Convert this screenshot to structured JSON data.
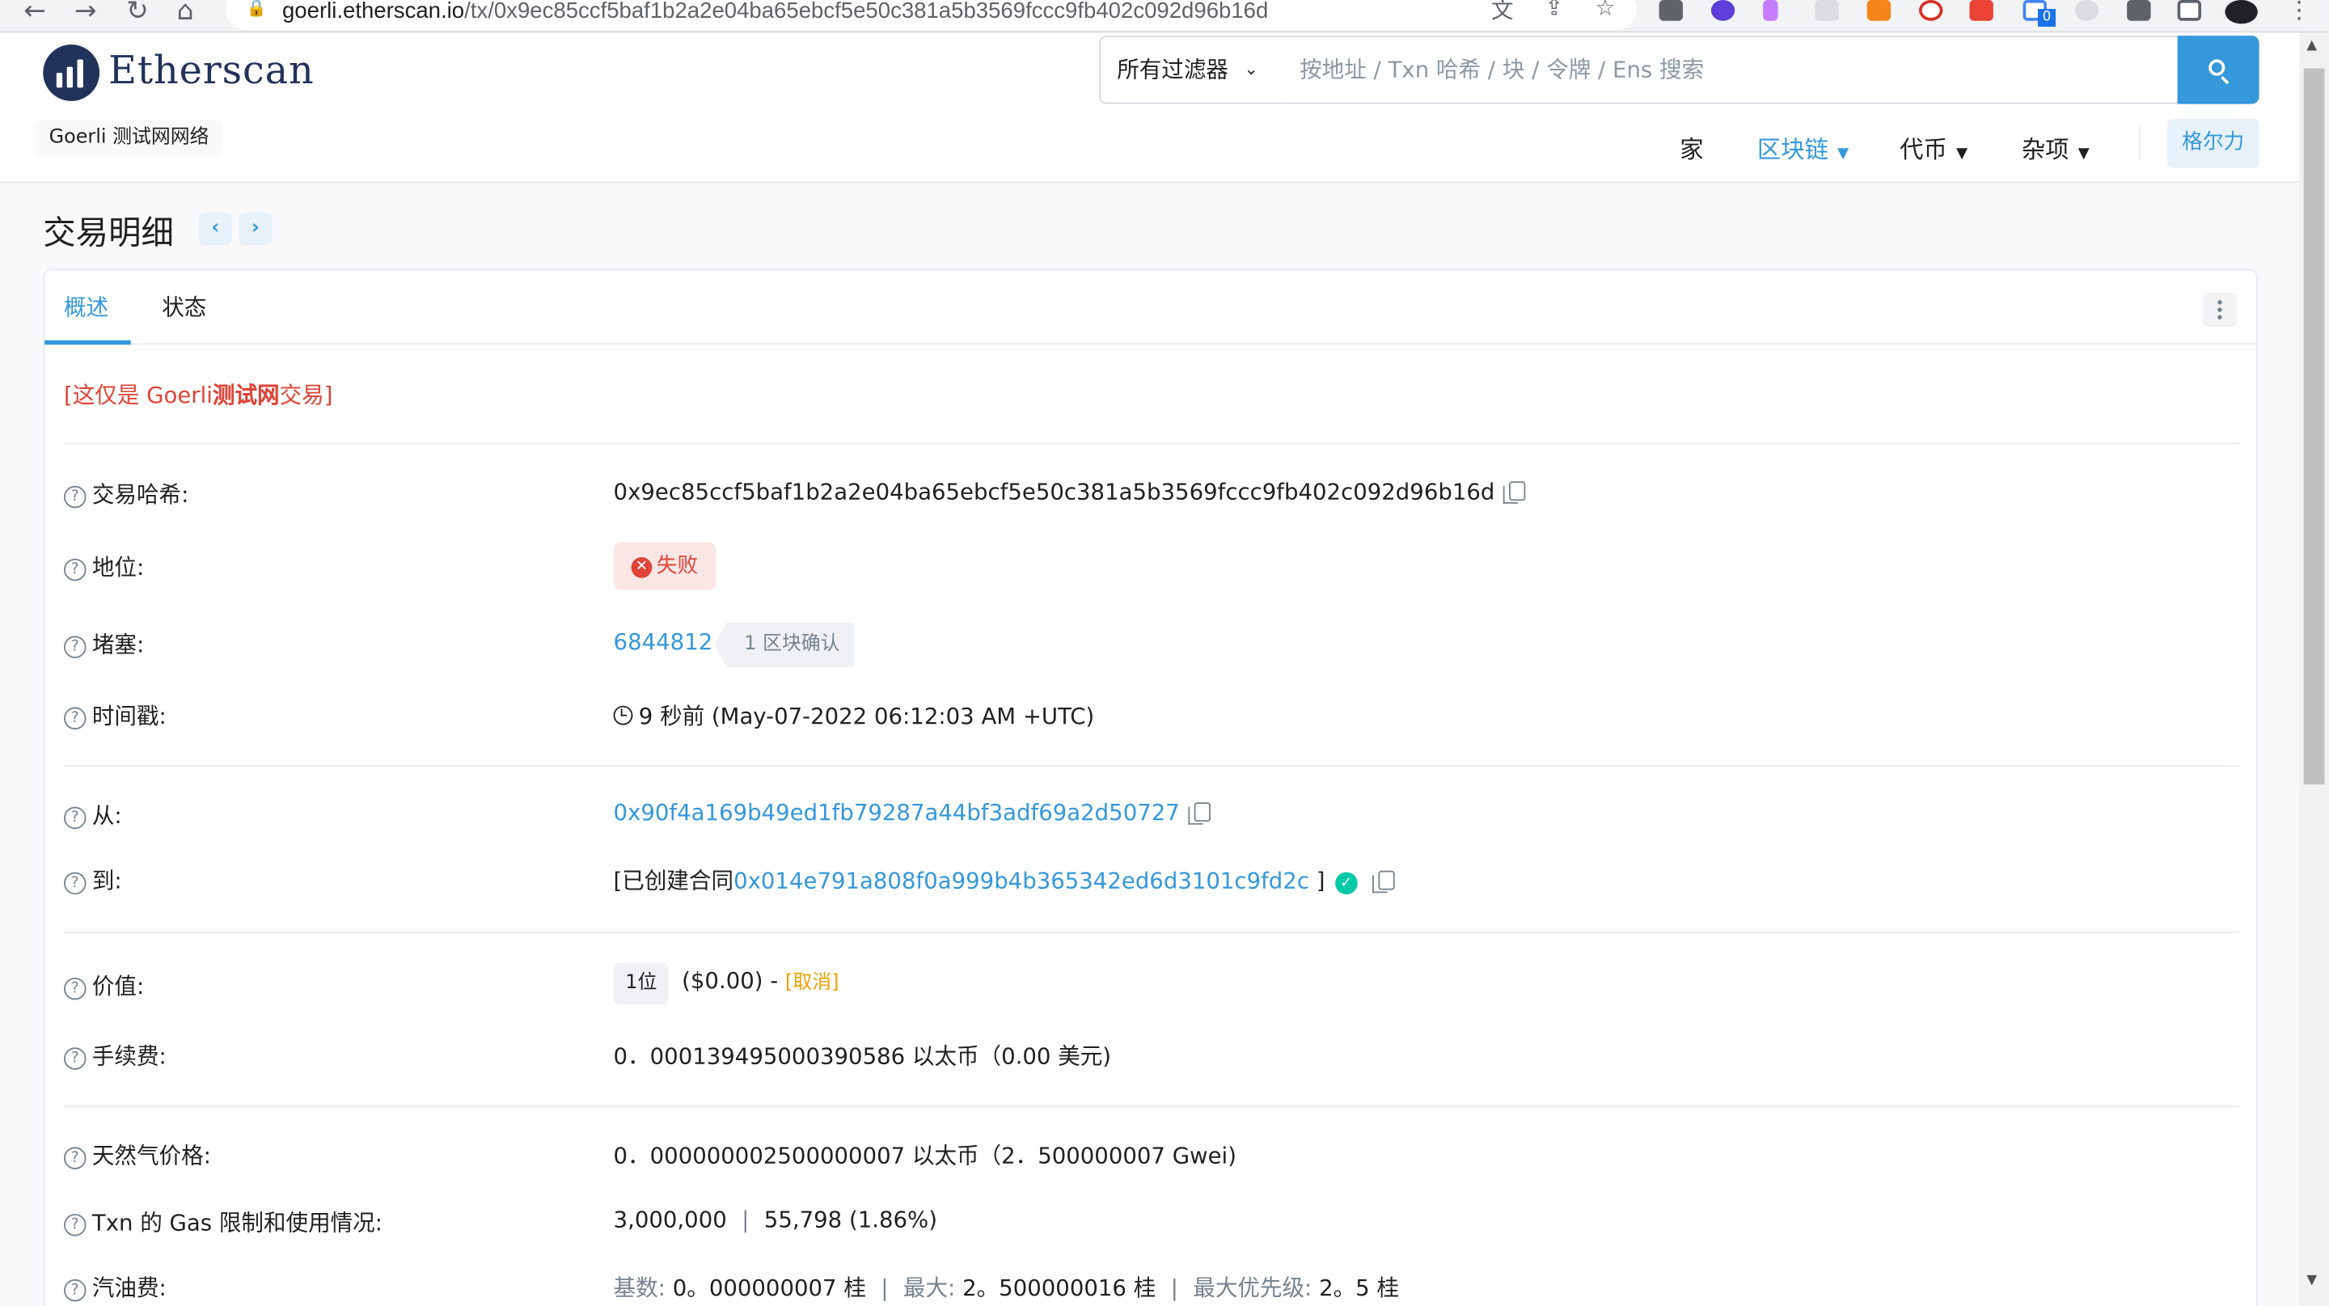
{
  "browser": {
    "url_host": "goerli.etherscan.io",
    "url_path": "/tx/0x9ec85ccf5baf1b2a2e04ba65ebcf5e50c381a5b3569fccc9fb402c092d96b16d",
    "ext_badge": "0"
  },
  "header": {
    "logo_text": "Etherscan",
    "network_badge": "Goerli 测试网网络",
    "filter_label": "所有过滤器",
    "search_placeholder": "按地址 / Txn 哈希 / 块 / 令牌 / Ens 搜索",
    "nav": {
      "home": "家",
      "blockchain": "区块链",
      "tokens": "代币",
      "misc": "杂项",
      "network": "格尔力"
    }
  },
  "page": {
    "title": "交易明细",
    "tabs": [
      "概述",
      "状态"
    ]
  },
  "overview": {
    "notice_prefix": "[这仅是 Goerli",
    "notice_bold": "测试网",
    "notice_suffix": "交易]",
    "tx_hash_label": "交易哈希:",
    "tx_hash": "0x9ec85ccf5baf1b2a2e04ba65ebcf5e50c381a5b3569fccc9fb402c092d96b16d",
    "status_label": "地位:",
    "status": "失败",
    "block_label": "堵塞:",
    "block": "6844812",
    "confirmations": "1 区块确认",
    "timestamp_label": "时间戳:",
    "timestamp": "9 秒前 (May-07-2022 06:12:03 AM +UTC)",
    "from_label": "从:",
    "from": "0x90f4a169b49ed1fb79287a44bf3adf69a2d50727",
    "to_label": "到:",
    "to_prefix": "[已创建合同",
    "to_contract": "0x014e791a808f0a999b4b365342ed6d3101c9fd2c",
    "to_suffix": "]",
    "value_label": "价值:",
    "value_badge": "1位",
    "value_usd": "($0.00) -",
    "value_cancel": "[取消]",
    "fee_label": "手续费:",
    "fee": "0．000139495000390586 以太币（0.00 美元)",
    "gas_price_label": "天然气价格:",
    "gas_price": "0．000000002500000007 以太币（2．500000007 Gwei)",
    "gas_limit_label": "Txn 的 Gas 限制和使用情况:",
    "gas_limit": "3,000,000",
    "gas_used": "55,798 (1.86%)",
    "gas_fees_label": "汽油费:",
    "gas_base_label": "基数:",
    "gas_base": "0。000000007 桂",
    "gas_max_label": "最大:",
    "gas_max": "2。500000016 桂",
    "gas_priority_label": "最大优先级:",
    "gas_priority": "2。5 桂"
  }
}
